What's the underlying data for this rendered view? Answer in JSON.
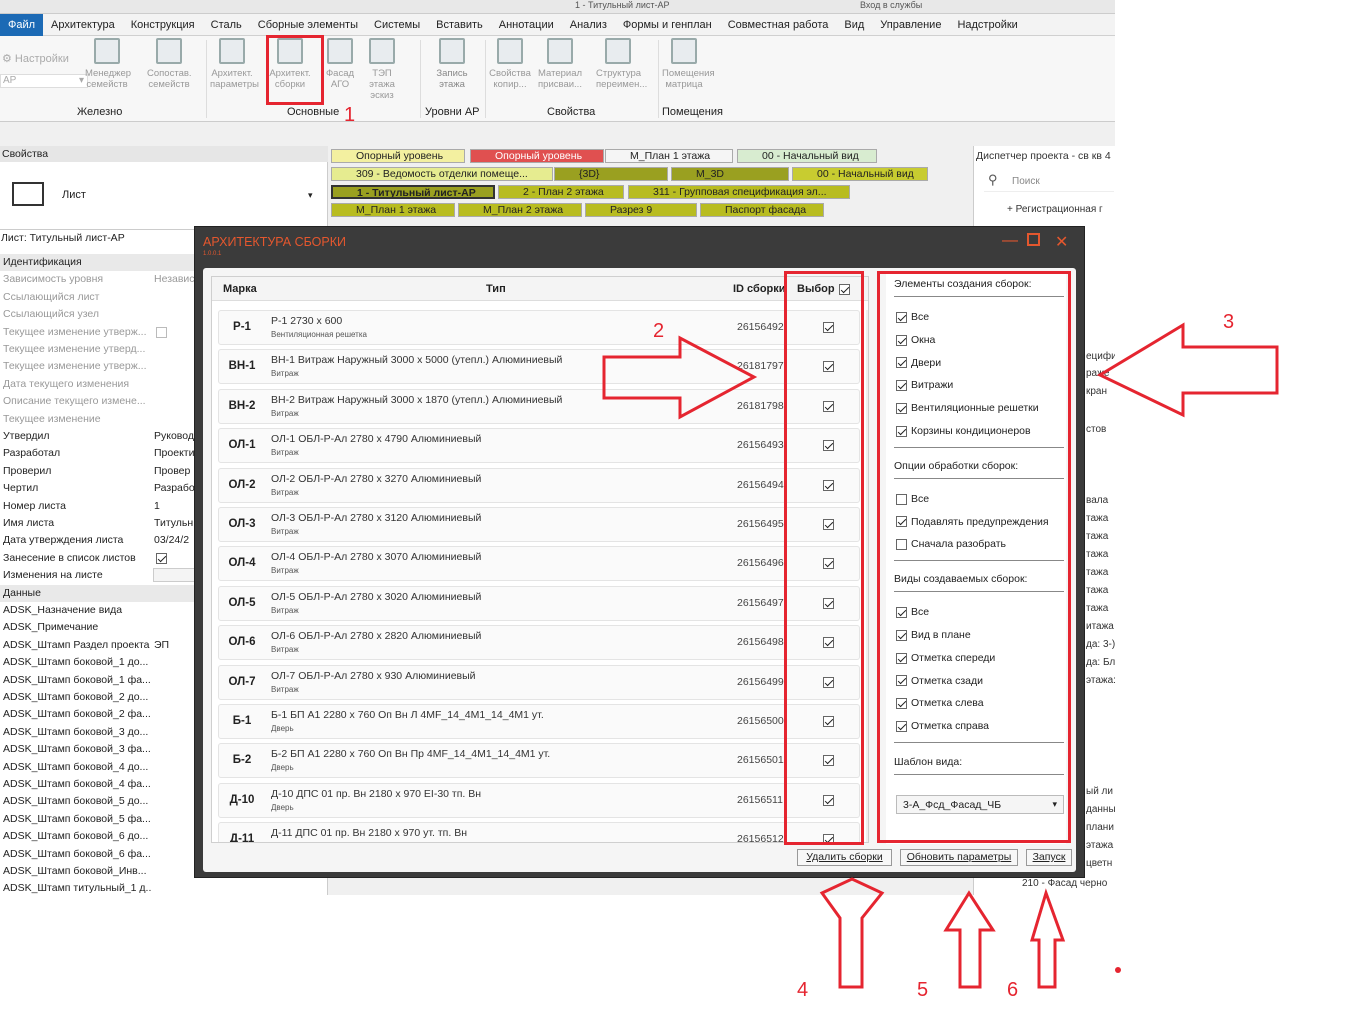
{
  "window": {
    "title_fragment": "1 - Титульный лист-АР",
    "login": "Вход в службы"
  },
  "menu": [
    {
      "label": "Файл",
      "active": true
    },
    {
      "label": "Архитектура"
    },
    {
      "label": "Конструкция"
    },
    {
      "label": "Сталь"
    },
    {
      "label": "Сборные элементы"
    },
    {
      "label": "Системы"
    },
    {
      "label": "Вставить"
    },
    {
      "label": "Аннотации"
    },
    {
      "label": "Анализ"
    },
    {
      "label": "Формы и генплан"
    },
    {
      "label": "Совместная работа"
    },
    {
      "label": "Вид"
    },
    {
      "label": "Управление"
    },
    {
      "label": "Надстройки"
    }
  ],
  "ribbon": {
    "settings": "Настройки",
    "dropdown": "АР",
    "buttons": [
      {
        "l1": "Менеджер",
        "l2": "семейств"
      },
      {
        "l1": "Сопостав.",
        "l2": "семейств"
      },
      {
        "l1": "Архитект.",
        "l2": "параметры"
      },
      {
        "l1": "Архитект.",
        "l2": "сборки"
      },
      {
        "l1": "Фасад",
        "l2": "АГО"
      },
      {
        "l1": "ТЭП этажа",
        "l2": "эскиз"
      },
      {
        "l1": "Запись",
        "l2": "этажа"
      },
      {
        "l1": "Свойства",
        "l2": "копир..."
      },
      {
        "l1": "Материал",
        "l2": "присваи..."
      },
      {
        "l1": "Структура",
        "l2": "переимен..."
      },
      {
        "l1": "Помещения",
        "l2": "матрица"
      }
    ],
    "groups": [
      "Железно",
      "Основные",
      "Уровни АР",
      "Свойства",
      "Помещения"
    ]
  },
  "props": {
    "title": "Свойства",
    "type": "Лист",
    "sheet": "Лист: Титульный лист-АР",
    "rows": [
      {
        "k": "Идентификация",
        "v": "",
        "hdr": true
      },
      {
        "k": "Зависимость уровня",
        "v": "Независ",
        "dim": true
      },
      {
        "k": "Ссылающийся лист",
        "v": "",
        "dim": true
      },
      {
        "k": "Ссылающийся узел",
        "v": "",
        "dim": true
      },
      {
        "k": "Текущее изменение утверж...",
        "v": "",
        "dim": true
      },
      {
        "k": "Текущее изменение утверд...",
        "v": "",
        "dim": true
      },
      {
        "k": "Текущее изменение утверж...",
        "v": "",
        "dim": true
      },
      {
        "k": "Дата текущего изменения",
        "v": "",
        "dim": true
      },
      {
        "k": "Описание текущего измене...",
        "v": "",
        "dim": true
      },
      {
        "k": "Текущее изменение",
        "v": "",
        "dim": true
      },
      {
        "k": "Утвердил",
        "v": "Руковод"
      },
      {
        "k": "Разработал",
        "v": "Проекти"
      },
      {
        "k": "Проверил",
        "v": "Провер"
      },
      {
        "k": "Чертил",
        "v": "Разрабо"
      },
      {
        "k": "Номер листа",
        "v": "1"
      },
      {
        "k": "Имя листа",
        "v": "Титульн"
      },
      {
        "k": "Дата утверждения листа",
        "v": "03/24/2"
      },
      {
        "k": "Занесение в список листов",
        "v": ""
      },
      {
        "k": "Изменения на листе",
        "v": ""
      },
      {
        "k": "Данные",
        "v": "",
        "hdr": true
      },
      {
        "k": "ADSK_Назначение вида",
        "v": ""
      },
      {
        "k": "ADSK_Примечание",
        "v": ""
      },
      {
        "k": "ADSK_Штамп Раздел проекта",
        "v": "ЭП"
      },
      {
        "k": "ADSK_Штамп боковой_1 до...",
        "v": ""
      },
      {
        "k": "ADSK_Штамп боковой_1 фа...",
        "v": ""
      },
      {
        "k": "ADSK_Штамп боковой_2 до...",
        "v": ""
      },
      {
        "k": "ADSK_Штамп боковой_2 фа...",
        "v": ""
      },
      {
        "k": "ADSK_Штамп боковой_3 до...",
        "v": ""
      },
      {
        "k": "ADSK_Штамп боковой_3 фа...",
        "v": ""
      },
      {
        "k": "ADSK_Штамп боковой_4 до...",
        "v": ""
      },
      {
        "k": "ADSK_Штамп боковой_4 фа...",
        "v": ""
      },
      {
        "k": "ADSK_Штамп боковой_5 до...",
        "v": ""
      },
      {
        "k": "ADSK_Штамп боковой_5 фа...",
        "v": ""
      },
      {
        "k": "ADSK_Штамп боковой_6 до...",
        "v": ""
      },
      {
        "k": "ADSK_Штамп боковой_6 фа...",
        "v": ""
      },
      {
        "k": "ADSK_Штамп боковой_Инв...",
        "v": ""
      },
      {
        "k": "ADSK_Штамп титульный_1 д...",
        "v": ""
      }
    ]
  },
  "view_tabs": [
    {
      "label": "Опорный уровень",
      "c": "#f3f0a0"
    },
    {
      "label": "Опорный уровень",
      "c": "#e05050"
    },
    {
      "label": "М_План 1 этажа",
      "c": "#f5f5f5"
    },
    {
      "label": "00 - Начальный вид",
      "c": "#d8ecd0"
    },
    {
      "label": "309 - Ведомость отделки помеще...",
      "c": "#e6ec90"
    },
    {
      "label": "{3D}",
      "c": "#9aa020"
    },
    {
      "label": "М_3D",
      "c": "#9aa020"
    },
    {
      "label": "00 - Начальный вид",
      "c": "#c8cc30"
    },
    {
      "label": "1 - Титульный лист-АР",
      "c": "#9aa020"
    },
    {
      "label": "2 - План 2 этажа",
      "c": "#b8bc20"
    },
    {
      "label": "311 - Групповая спецификация эл...",
      "c": "#b8bc20"
    },
    {
      "label": "М_План 1 этажа",
      "c": "#b8bc20"
    },
    {
      "label": "М_План 2 этажа",
      "c": "#b8bc20"
    },
    {
      "label": "Разрез 9",
      "c": "#b8bc20"
    },
    {
      "label": "Паспорт фасада",
      "c": "#b8bc20"
    }
  ],
  "browser": {
    "title": "Диспетчер проекта - св кв 4",
    "search": "Поиск",
    "reg": "Регистрационная г",
    "frag": [
      "ецифи",
      "раже",
      "кран",
      "стов",
      "вала",
      "тажа",
      "тажа",
      "тажа",
      "тажа",
      "тажа",
      "тажа",
      "итажа",
      "да: 3-)",
      "да: Бл",
      "этажа:",
      "ый ли",
      "данны",
      "плани",
      "этажа",
      "цветн"
    ],
    "bottom": "210 - Фасад черно"
  },
  "dialog": {
    "title": "АРХИТЕКТУРА СБОРКИ",
    "version": "1.0.0.1",
    "columns": {
      "mark": "Марка",
      "type": "Тип",
      "id": "ID сборки",
      "select": "Выбор"
    },
    "rows": [
      {
        "mark": "Р-1",
        "t1": "Р-1 2730 х 600",
        "t2": "Вентиляционная решетка",
        "id": "26156492"
      },
      {
        "mark": "ВН-1",
        "t1": "ВН-1 Витраж Наружный 3000 х 5000 (утепл.) Алюминиевый",
        "t2": "Витраж",
        "id": "26181797"
      },
      {
        "mark": "ВН-2",
        "t1": "ВН-2 Витраж Наружный 3000 х 1870 (утепл.) Алюминиевый",
        "t2": "Витраж",
        "id": "26181798"
      },
      {
        "mark": "ОЛ-1",
        "t1": "ОЛ-1 ОБЛ-Р-Ал 2780 х 4790 Алюминиевый",
        "t2": "Витраж",
        "id": "26156493"
      },
      {
        "mark": "ОЛ-2",
        "t1": "ОЛ-2 ОБЛ-Р-Ал 2780 х 3270 Алюминиевый",
        "t2": "Витраж",
        "id": "26156494"
      },
      {
        "mark": "ОЛ-3",
        "t1": "ОЛ-3 ОБЛ-Р-Ал 2780 х 3120 Алюминиевый",
        "t2": "Витраж",
        "id": "26156495"
      },
      {
        "mark": "ОЛ-4",
        "t1": "ОЛ-4 ОБЛ-Р-Ал 2780 х 3070 Алюминиевый",
        "t2": "Витраж",
        "id": "26156496"
      },
      {
        "mark": "ОЛ-5",
        "t1": "ОЛ-5 ОБЛ-Р-Ал 2780 х 3020 Алюминиевый",
        "t2": "Витраж",
        "id": "26156497"
      },
      {
        "mark": "ОЛ-6",
        "t1": "ОЛ-6 ОБЛ-Р-Ал 2780 х 2820 Алюминиевый",
        "t2": "Витраж",
        "id": "26156498"
      },
      {
        "mark": "ОЛ-7",
        "t1": "ОЛ-7 ОБЛ-Р-Ал 2780 х 930 Алюминиевый",
        "t2": "Витраж",
        "id": "26156499"
      },
      {
        "mark": "Б-1",
        "t1": "Б-1 БП А1 2280 х 760 Оп Вн Л 4MF_14_4M1_14_4M1 ут.",
        "t2": "Дверь",
        "id": "26156500"
      },
      {
        "mark": "Б-2",
        "t1": "Б-2 БП А1 2280 х 760 Оп Вн Пр 4MF_14_4M1_14_4M1 ут.",
        "t2": "Дверь",
        "id": "26156501"
      },
      {
        "mark": "Д-10",
        "t1": "Д-10 ДПС 01 пр. Вн 2180 х 970 ЕI-30 тп. Вн",
        "t2": "Дверь",
        "id": "26156511"
      },
      {
        "mark": "Д-11",
        "t1": "Д-11 ДПС 01 пр. Вн 2180 х 970 ут. тп. Вн",
        "t2": "Дверь",
        "id": "26156512"
      }
    ],
    "sections": [
      {
        "title": "Элементы создания сборок:",
        "items": [
          {
            "l": "Все",
            "on": true
          },
          {
            "l": "Окна",
            "on": true
          },
          {
            "l": "Двери",
            "on": true
          },
          {
            "l": "Витражи",
            "on": true
          },
          {
            "l": "Вентиляционные решетки",
            "on": true
          },
          {
            "l": "Корзины кондиционеров",
            "on": true
          }
        ]
      },
      {
        "title": "Опции обработки сборок:",
        "items": [
          {
            "l": "Все",
            "on": false
          },
          {
            "l": "Подавлять предупреждения",
            "on": true
          },
          {
            "l": "Сначала разобрать",
            "on": false
          }
        ]
      },
      {
        "title": "Виды создаваемых сборок:",
        "items": [
          {
            "l": "Все",
            "on": true
          },
          {
            "l": "Вид в плане",
            "on": true
          },
          {
            "l": "Отметка спереди",
            "on": true
          },
          {
            "l": "Отметка сзади",
            "on": true
          },
          {
            "l": "Отметка слева",
            "on": true
          },
          {
            "l": "Отметка справа",
            "on": true
          }
        ]
      }
    ],
    "template_label": "Шаблон вида:",
    "template_value": "3-А_Фсд_Фасад_ЧБ",
    "buttons": {
      "delete": "Удалить сборки",
      "update": "Обновить параметры",
      "run": "Запуск"
    }
  },
  "annotations": [
    "1",
    "2",
    "3",
    "4",
    "5",
    "6"
  ],
  "annotation_color": "#e52530"
}
